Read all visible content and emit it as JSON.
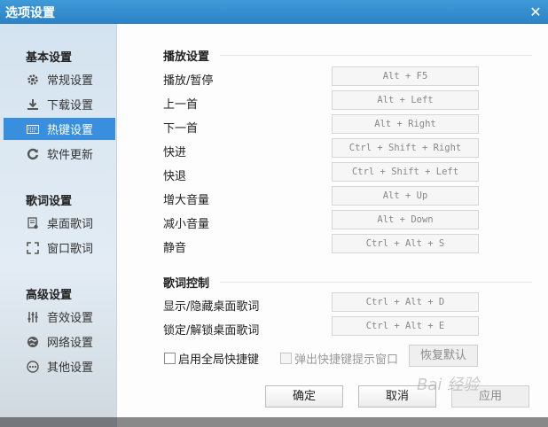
{
  "window": {
    "title": "选项设置"
  },
  "sidebar": {
    "groups": [
      {
        "title": "基本设置",
        "items": [
          {
            "label": "常规设置",
            "icon": "gear-icon"
          },
          {
            "label": "下载设置",
            "icon": "download-icon"
          },
          {
            "label": "热键设置",
            "icon": "keyboard-icon",
            "active": true
          },
          {
            "label": "软件更新",
            "icon": "update-icon"
          }
        ]
      },
      {
        "title": "歌词设置",
        "items": [
          {
            "label": "桌面歌词",
            "icon": "desktop-lyrics-icon"
          },
          {
            "label": "窗口歌词",
            "icon": "window-lyrics-icon"
          }
        ]
      },
      {
        "title": "高级设置",
        "items": [
          {
            "label": "音效设置",
            "icon": "equalizer-icon"
          },
          {
            "label": "网络设置",
            "icon": "network-icon"
          },
          {
            "label": "其他设置",
            "icon": "more-icon"
          }
        ]
      }
    ]
  },
  "playback": {
    "title": "播放设置",
    "rows": [
      {
        "label": "播放/暂停",
        "hotkey": "Alt + F5"
      },
      {
        "label": "上一首",
        "hotkey": "Alt + Left"
      },
      {
        "label": "下一首",
        "hotkey": "Alt + Right"
      },
      {
        "label": "快进",
        "hotkey": "Ctrl + Shift + Right"
      },
      {
        "label": "快退",
        "hotkey": "Ctrl + Shift + Left"
      },
      {
        "label": "增大音量",
        "hotkey": "Alt + Up"
      },
      {
        "label": "减小音量",
        "hotkey": "Alt + Down"
      },
      {
        "label": "静音",
        "hotkey": "Ctrl + Alt + S"
      }
    ]
  },
  "lyrics": {
    "title": "歌词控制",
    "rows": [
      {
        "label": "显示/隐藏桌面歌词",
        "hotkey": "Ctrl + Alt + D"
      },
      {
        "label": "锁定/解锁桌面歌词",
        "hotkey": "Ctrl + Alt + E"
      }
    ]
  },
  "options": {
    "global_hotkey": "启用全局快捷键",
    "show_tip": "弹出快捷键提示窗口",
    "restore_default": "恢复默认"
  },
  "footer": {
    "ok": "确定",
    "cancel": "取消",
    "apply": "应用"
  },
  "watermark": "Bai 经验"
}
